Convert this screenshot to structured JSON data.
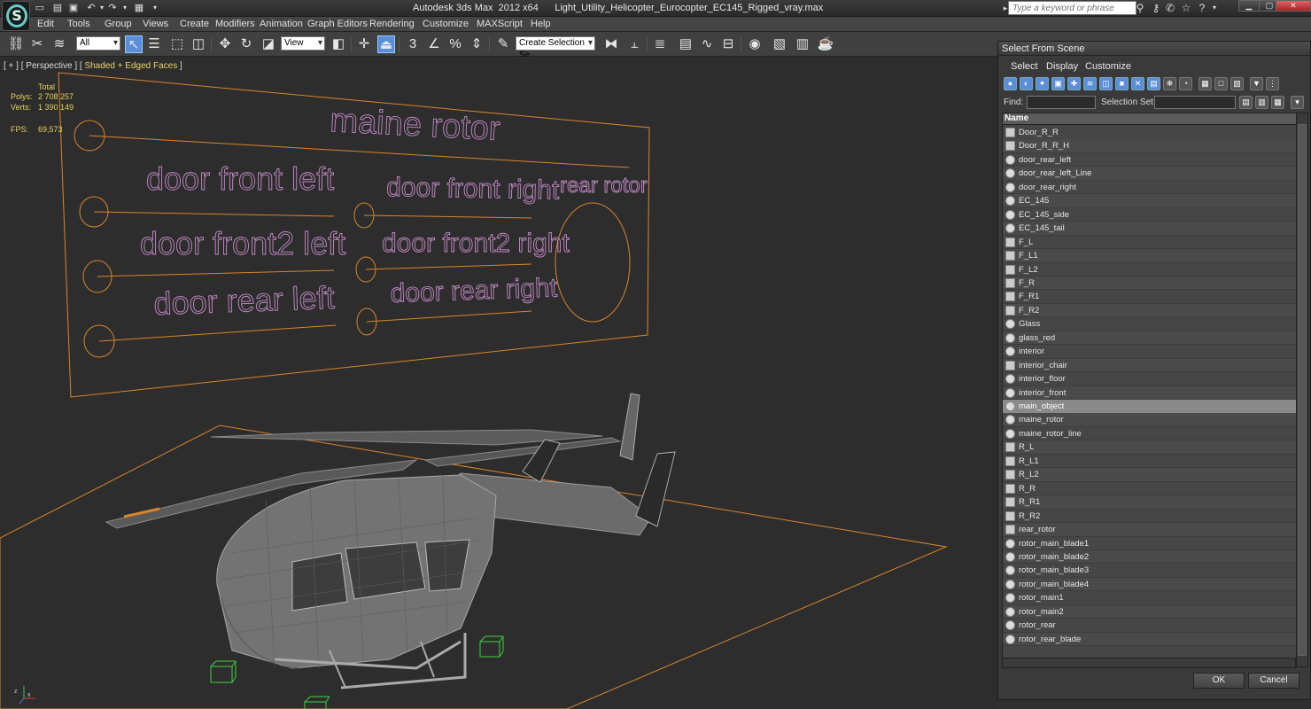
{
  "window": {
    "title": "Autodesk 3ds Max  2012 x64      Light_Utility_Helicopter_Eurocopter_EC145_Rigged_vray.max",
    "search_placeholder": "Type a keyword or phrase"
  },
  "menu": [
    "Edit",
    "Tools",
    "Group",
    "Views",
    "Create",
    "Modifiers",
    "Animation",
    "Graph Editors",
    "Rendering",
    "Customize",
    "MAXScript",
    "Help"
  ],
  "toolbar": {
    "filter_value": "All",
    "refcoord_value": "View",
    "selection_set_value": "Create Selection Se",
    "snap_label": "3"
  },
  "viewport": {
    "label_prefix": "[ + ] [ Perspective ] [ ",
    "label_shading": "Shaded + Edged Faces",
    "label_suffix": " ]",
    "stats": {
      "total_label": "Total",
      "polys_label": "Polys:",
      "polys_value": "2 708 257",
      "verts_label": "Verts:",
      "verts_value": "1 390 149",
      "fps_label": "FPS:",
      "fps_value": "69,573"
    },
    "labels": {
      "main_rotor": "maine rotor",
      "door_front_left": "door front left",
      "door_front_right": "door front right",
      "rear_rotor": "rear rotor",
      "door_front2_left": "door front2 left",
      "door_front2_right": "door front2 right",
      "door_rear_left": "door rear left",
      "door_rear_right": "door rear right"
    }
  },
  "dialog": {
    "title": "Select From Scene",
    "menu": [
      "Select",
      "Display",
      "Customize"
    ],
    "find_label": "Find:",
    "selection_set_label": "Selection Set:",
    "column_name": "Name",
    "ok_label": "OK",
    "cancel_label": "Cancel",
    "items": [
      {
        "name": "Door_R_R",
        "icon": "group"
      },
      {
        "name": "Door_R_R_H",
        "icon": "group"
      },
      {
        "name": "door_rear_left",
        "icon": "object"
      },
      {
        "name": "door_rear_left_Line",
        "icon": "object"
      },
      {
        "name": "door_rear_right",
        "icon": "object"
      },
      {
        "name": "EC_145",
        "icon": "object"
      },
      {
        "name": "EC_145_side",
        "icon": "object"
      },
      {
        "name": "EC_145_tail",
        "icon": "object"
      },
      {
        "name": "F_L",
        "icon": "group"
      },
      {
        "name": "F_L1",
        "icon": "group"
      },
      {
        "name": "F_L2",
        "icon": "group"
      },
      {
        "name": "F_R",
        "icon": "group"
      },
      {
        "name": "F_R1",
        "icon": "group"
      },
      {
        "name": "F_R2",
        "icon": "group"
      },
      {
        "name": "Glass",
        "icon": "object"
      },
      {
        "name": "glass_red",
        "icon": "object"
      },
      {
        "name": "interior",
        "icon": "object"
      },
      {
        "name": "interior_chair",
        "icon": "group"
      },
      {
        "name": "interior_floor",
        "icon": "object"
      },
      {
        "name": "interior_front",
        "icon": "object"
      },
      {
        "name": "main_object",
        "icon": "object",
        "selected": true
      },
      {
        "name": "maine_rotor",
        "icon": "object"
      },
      {
        "name": "maine_rotor_line",
        "icon": "object"
      },
      {
        "name": "R_L",
        "icon": "group"
      },
      {
        "name": "R_L1",
        "icon": "group"
      },
      {
        "name": "R_L2",
        "icon": "group"
      },
      {
        "name": "R_R",
        "icon": "group"
      },
      {
        "name": "R_R1",
        "icon": "group"
      },
      {
        "name": "R_R2",
        "icon": "group"
      },
      {
        "name": "rear_rotor",
        "icon": "group"
      },
      {
        "name": "rotor_main_blade1",
        "icon": "object"
      },
      {
        "name": "rotor_main_blade2",
        "icon": "object"
      },
      {
        "name": "rotor_main_blade3",
        "icon": "object"
      },
      {
        "name": "rotor_main_blade4",
        "icon": "object"
      },
      {
        "name": "rotor_main1",
        "icon": "object"
      },
      {
        "name": "rotor_main2",
        "icon": "object"
      },
      {
        "name": "rotor_rear",
        "icon": "object"
      },
      {
        "name": "rotor_rear_blade",
        "icon": "object"
      }
    ]
  },
  "colors": {
    "wireframe_orange": "#d9852b",
    "label_pink": "#c58ac8",
    "helper_green": "#3fd13f",
    "selection_blue": "#5a8ed8"
  }
}
